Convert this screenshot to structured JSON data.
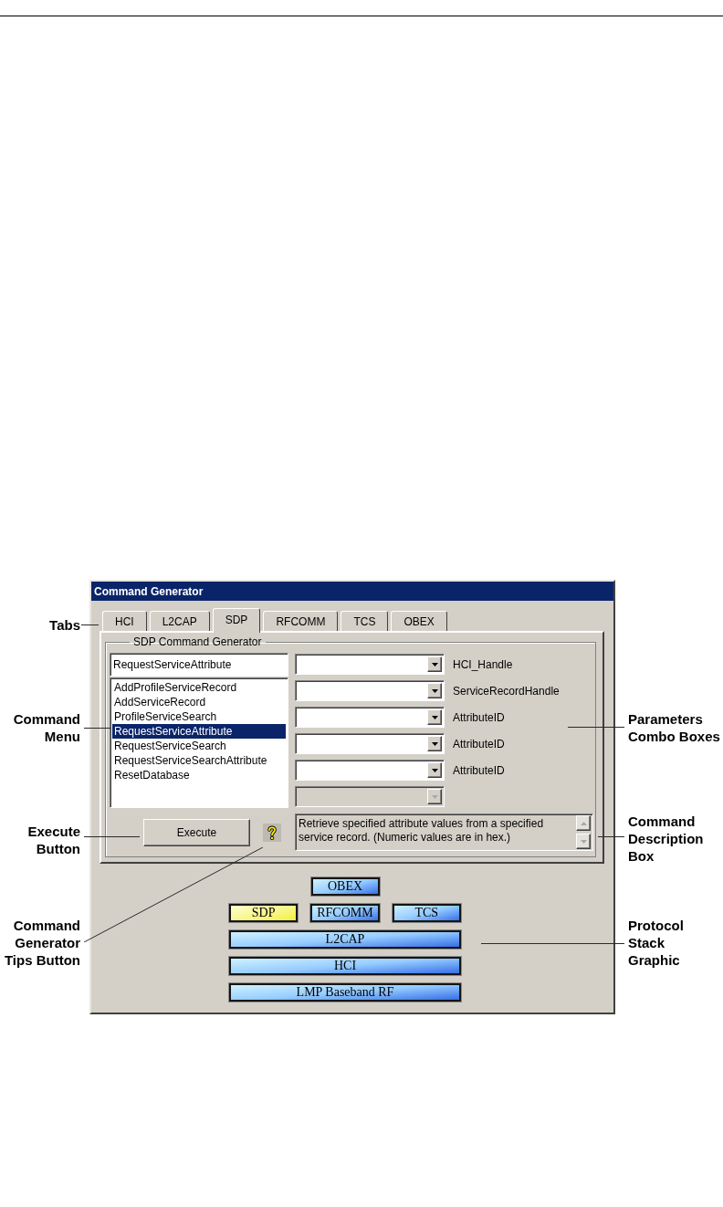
{
  "dialog": {
    "title": "Command Generator",
    "tabs": [
      {
        "label": "HCI",
        "selected": false
      },
      {
        "label": "L2CAP",
        "selected": false
      },
      {
        "label": "SDP",
        "selected": true
      },
      {
        "label": "RFCOMM",
        "selected": false
      },
      {
        "label": "TCS",
        "selected": false
      },
      {
        "label": "OBEX",
        "selected": false
      }
    ],
    "group": {
      "title": "SDP Command Generator",
      "command_field": {
        "value": "RequestServiceAttribute"
      },
      "command_list": [
        {
          "label": "AddProfileServiceRecord",
          "selected": false
        },
        {
          "label": "AddServiceRecord",
          "selected": false
        },
        {
          "label": "ProfileServiceSearch",
          "selected": false
        },
        {
          "label": "RequestServiceAttribute",
          "selected": true
        },
        {
          "label": "RequestServiceSearch",
          "selected": false
        },
        {
          "label": "RequestServiceSearchAttribute",
          "selected": false
        },
        {
          "label": "ResetDatabase",
          "selected": false
        }
      ],
      "parameters": [
        {
          "label": "HCI_Handle",
          "disabled": false
        },
        {
          "label": "ServiceRecordHandle",
          "disabled": false
        },
        {
          "label": "AttributeID",
          "disabled": false
        },
        {
          "label": "AttributeID",
          "disabled": false
        },
        {
          "label": "AttributeID",
          "disabled": false
        },
        {
          "disabled": true
        }
      ],
      "execute_button": "Execute",
      "description": "Retrieve specified attribute values from a specified service record. (Numeric values are in hex.)"
    },
    "protocol_stack": {
      "top": [
        {
          "label": "OBEX",
          "selected": false
        }
      ],
      "middle": [
        {
          "label": "SDP",
          "selected": true
        },
        {
          "label": "RFCOMM",
          "selected": false
        },
        {
          "label": "TCS",
          "selected": false
        }
      ],
      "bottom": [
        {
          "label": "L2CAP",
          "selected": false
        },
        {
          "label": "HCI",
          "selected": false
        },
        {
          "label": "LMP Baseband RF",
          "selected": false
        }
      ]
    }
  },
  "callouts": [
    {
      "text": "Tabs"
    },
    {
      "text": "Command\nMenu"
    },
    {
      "text": "Parameters\nCombo Boxes"
    },
    {
      "text": "Execute\nButton"
    },
    {
      "text": "Command\nDescription\nBox"
    },
    {
      "text": "Command\nGenerator\nTips Button"
    },
    {
      "text": "Protocol\nStack\nGraphic"
    }
  ]
}
